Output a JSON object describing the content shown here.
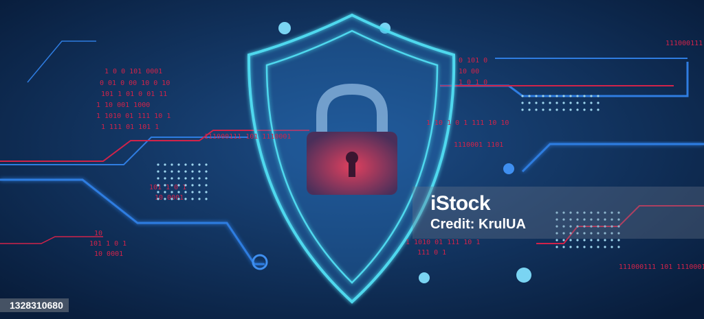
{
  "image": {
    "subject": "shield-with-padlock-cybersecurity-illustration",
    "colors": {
      "background": "#0b2447",
      "circuit_blue": "#2f7de1",
      "circuit_red": "#d2234a",
      "shield_glow": "#4fd8ee",
      "lock_red": "#c8324f"
    }
  },
  "binary_text": {
    "left": [
      "1 0 0  101  0001",
      "0 01 0 00  10 0  10",
      "101 1  01 0  01  11",
      "1 10  001  1000",
      "1 1010 01 111  10 1",
      "1 111   01    101  1",
      "101 1    0    1",
      "10  0001",
      "10",
      "101 1   0    1",
      "10   0001"
    ],
    "center": [
      "111000111 101 1110001",
      "0 101  0",
      "10 00",
      "1  0 1  0",
      "1 10 1 0 1 111  10 10",
      "1110001   1101",
      "1 1010 01 111  10  1",
      "111 0 1"
    ],
    "right": [
      "111000111",
      "111000111  101  1110001"
    ]
  },
  "watermark": {
    "logo": "iStock",
    "credit": "Credit: KrulUA"
  },
  "image_id": "1328310680"
}
